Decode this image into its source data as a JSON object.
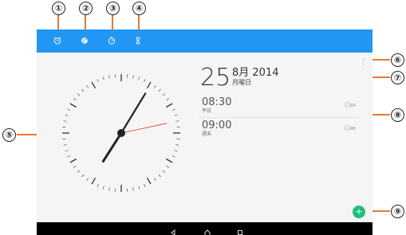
{
  "callouts": [
    "①",
    "②",
    "③",
    "④",
    "⑤",
    "⑥",
    "⑦",
    "⑧",
    "⑨"
  ],
  "colors": {
    "accent": "#e87a2a",
    "tabbar": "#2196f3",
    "fab": "#1fbf7a",
    "second_hand": "#e53935"
  },
  "tabs": [
    {
      "icon": "alarm-icon"
    },
    {
      "icon": "world-clock-icon"
    },
    {
      "icon": "stopwatch-icon"
    },
    {
      "icon": "timer-icon"
    }
  ],
  "menu": {
    "icon": "overflow-menu-icon",
    "glyph": "⋮"
  },
  "clock": {
    "hour": 7,
    "minute": 5,
    "second": 13
  },
  "date": {
    "day": "25",
    "month_year": "8月 2014",
    "weekday": "月曜日"
  },
  "alarms": [
    {
      "time": "08:30",
      "label": "平日",
      "enabled": false
    },
    {
      "time": "09:00",
      "label": "週末",
      "enabled": false
    }
  ],
  "fab": {
    "icon": "add-icon",
    "glyph": "+"
  },
  "navbar": [
    "back-icon",
    "home-icon",
    "recents-icon"
  ]
}
